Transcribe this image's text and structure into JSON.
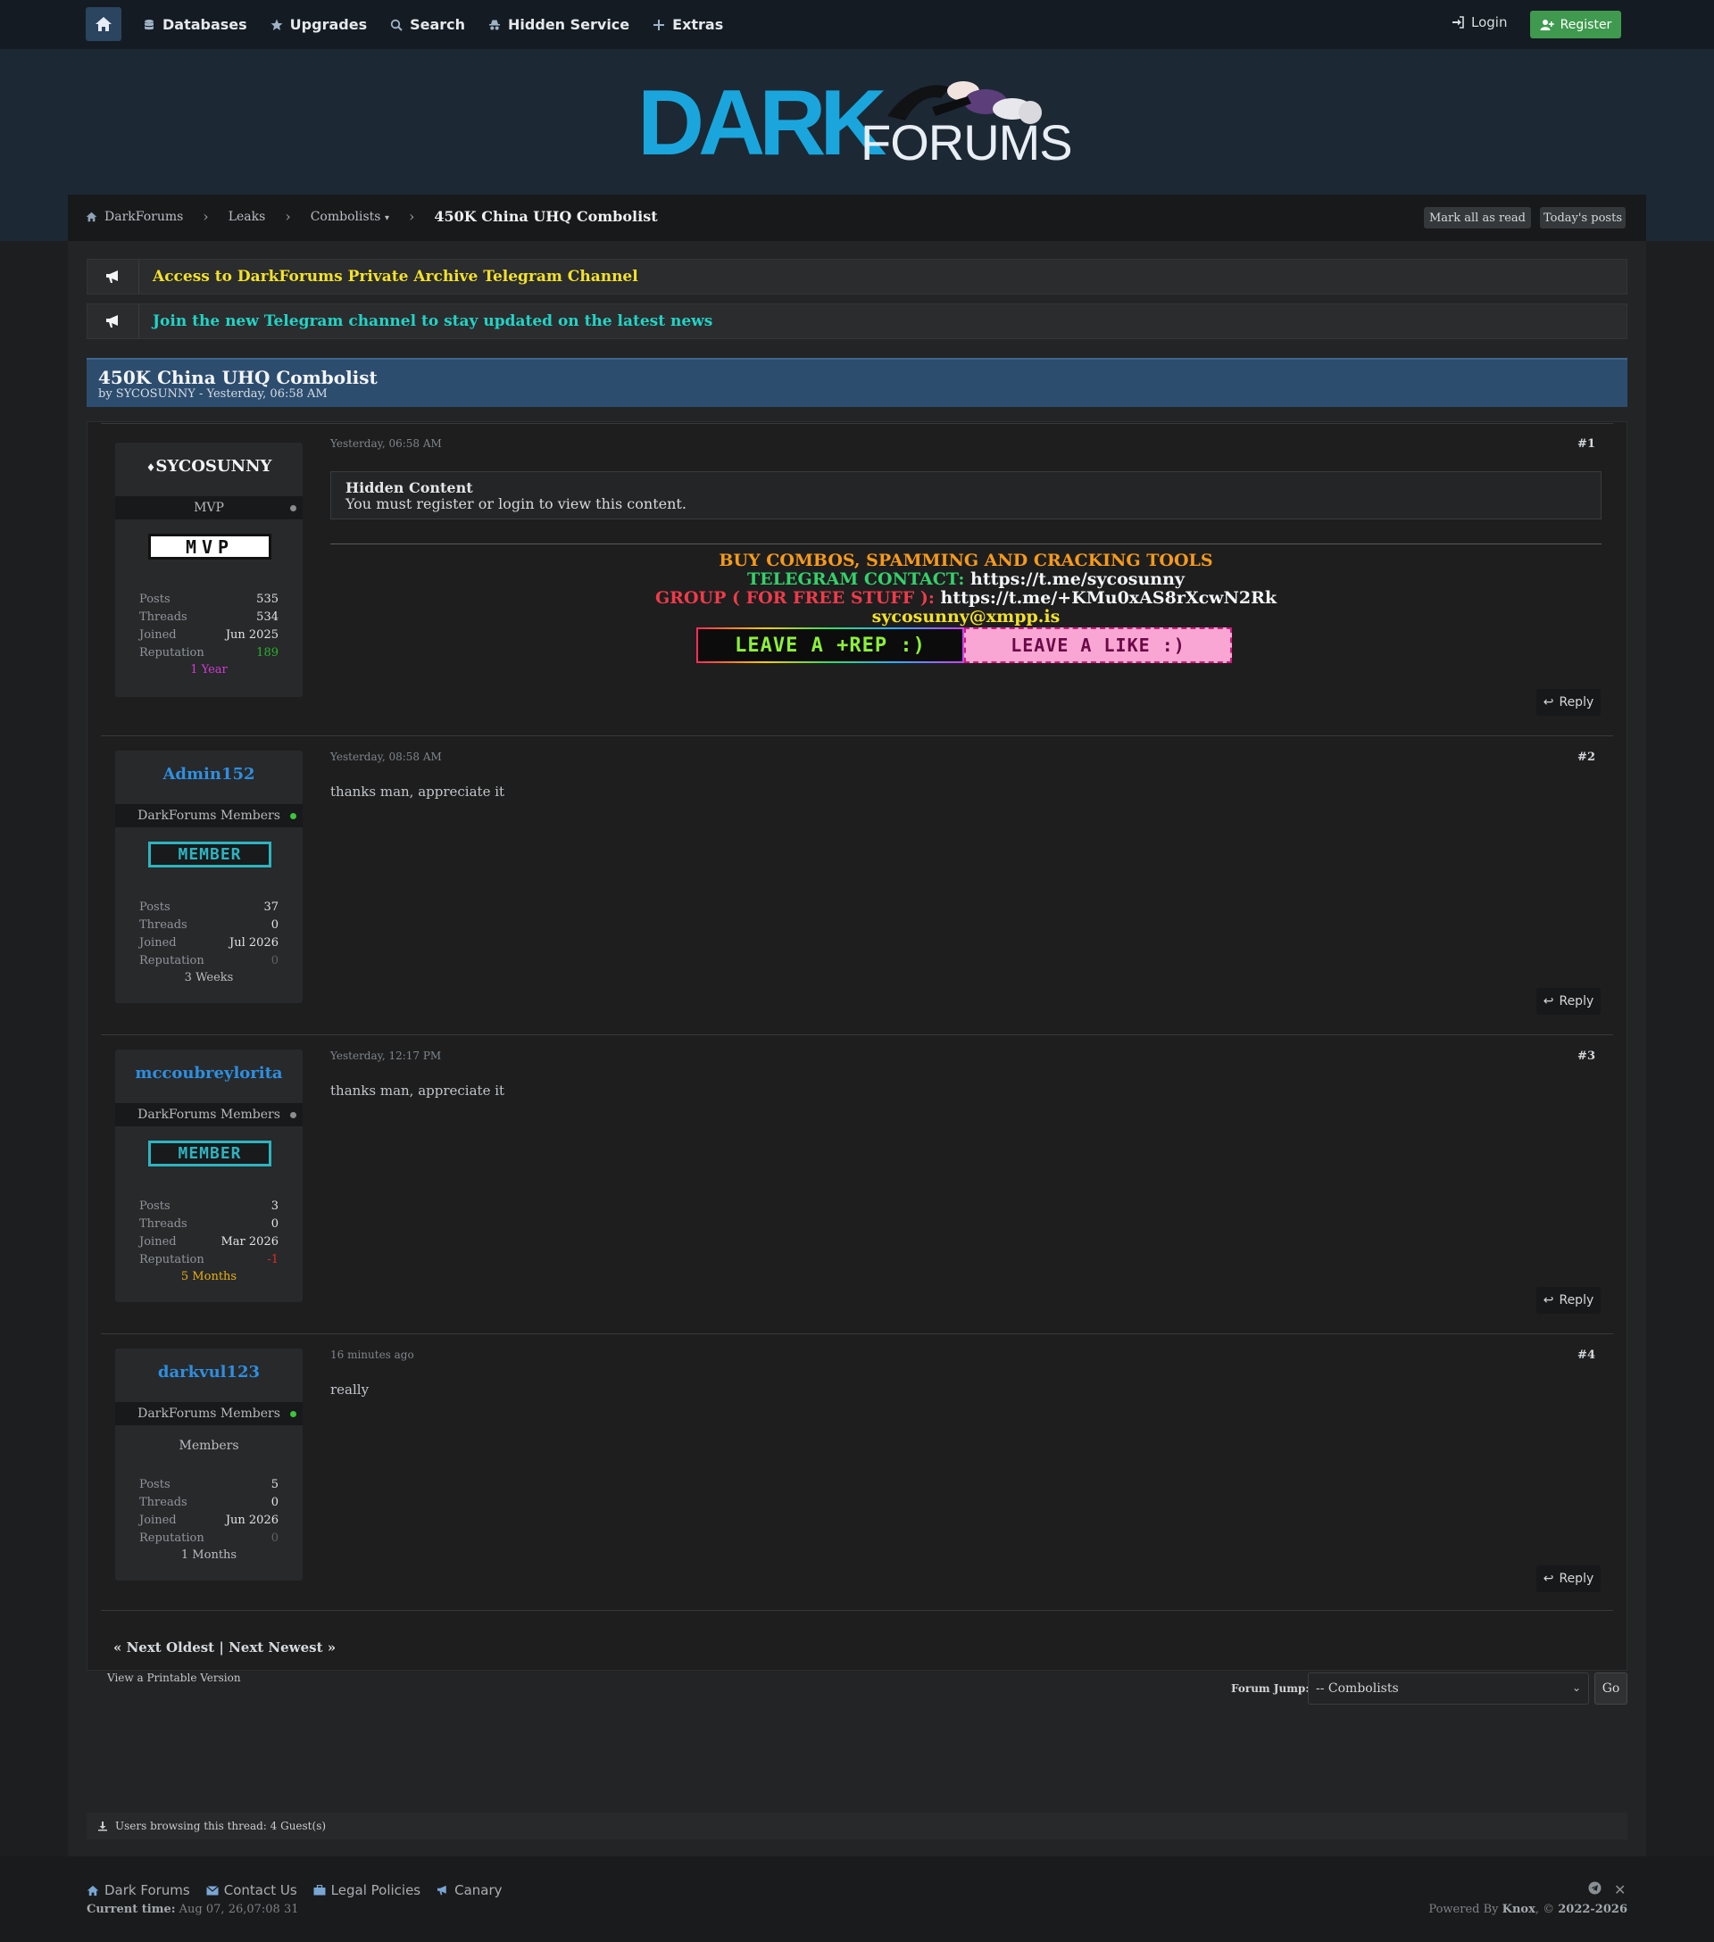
{
  "nav": {
    "items": [
      {
        "label": "Databases",
        "icon": "database-icon"
      },
      {
        "label": "Upgrades",
        "icon": "star-icon"
      },
      {
        "label": "Search",
        "icon": "search-icon"
      },
      {
        "label": "Hidden Service",
        "icon": "incognito-icon"
      },
      {
        "label": "Extras",
        "icon": "plus-icon"
      }
    ],
    "login": "Login",
    "register": "Register"
  },
  "logo": {
    "part1": "DARK",
    "part2": "FORUMS"
  },
  "breadcrumb": {
    "home": "DarkForums",
    "leaks": "Leaks",
    "combolists": "Combolists",
    "combolists_arrow": "▾",
    "current": "450K China UHQ Combolist"
  },
  "actions": {
    "mark_read": "Mark all as read",
    "todays_posts": "Today's posts"
  },
  "announcements": [
    {
      "text": "Access to DarkForums Private Archive Telegram Channel",
      "color": "#f2e12a"
    },
    {
      "text": "Join the new Telegram channel to stay updated on the latest news",
      "color": "#22d3c5"
    }
  ],
  "thread": {
    "title": "450K China UHQ Combolist",
    "subtitle": "by SYCOSUNNY - Yesterday, 06:58 AM"
  },
  "colors": {
    "link_blue": "#2e8fe0",
    "online": "#3ec43e",
    "offline": "#8a8d90",
    "rep_positive": "#29b12c",
    "rep_negative": "#e02a2a",
    "rep_zero": "#5e6267"
  },
  "posts": [
    {
      "username": "SYCOSUNNY",
      "group": "MVP",
      "online": false,
      "badge": "MVP",
      "stats": {
        "posts": "535",
        "threads": "534",
        "joined": "Jun 2025",
        "reputation": "189"
      },
      "tenure": "1 Year",
      "date": "Yesterday, 06:58 AM",
      "number": "#1",
      "hidden_title": "Hidden Content",
      "hidden_text": "You must register or login to view this content.",
      "sig": {
        "line1": "BUY COMBOS, SPAMMING AND CRACKING TOOLS",
        "line2_label": "TELEGRAM CONTACT:",
        "line2_value": "https://t.me/sycosunny",
        "line3_label": "GROUP ( FOR FREE STUFF ):",
        "line3_value": "https://t.me/+KMu0xAS8rXcwN2Rk",
        "line4": "sycosunny@xmpp.is",
        "banner1": "LEAVE A +REP :)",
        "banner2": "LEAVE A LIKE :)"
      }
    },
    {
      "username": "Admin152",
      "group": "DarkForums Members",
      "online": true,
      "badge": "MEMBER",
      "stats": {
        "posts": "37",
        "threads": "0",
        "joined": "Jul 2026",
        "reputation": "0"
      },
      "tenure": "3 Weeks",
      "date": "Yesterday, 08:58 AM",
      "number": "#2",
      "body": "thanks man, appreciate it"
    },
    {
      "username": "mccoubreylorita",
      "group": "DarkForums Members",
      "online": false,
      "badge": "MEMBER",
      "stats": {
        "posts": "3",
        "threads": "0",
        "joined": "Mar 2026",
        "reputation": "-1"
      },
      "tenure": "5 Months",
      "date": "Yesterday, 12:17 PM",
      "number": "#3",
      "body": "thanks man, appreciate it"
    },
    {
      "username": "darkvul123",
      "group": "DarkForums Members",
      "online": true,
      "group_text": "Members",
      "stats": {
        "posts": "5",
        "threads": "0",
        "joined": "Jun 2026",
        "reputation": "0"
      },
      "tenure": "1 Months",
      "date": "16 minutes ago",
      "number": "#4",
      "body": "really"
    }
  ],
  "labels": {
    "posts": "Posts",
    "threads": "Threads",
    "joined": "Joined",
    "reputation": "Reputation",
    "reply": "Reply"
  },
  "pagenav": {
    "oldest": "« Next Oldest",
    "sep": "|",
    "newest": "Next Newest »"
  },
  "printable": "View a Printable Version",
  "forum_jump": {
    "label": "Forum Jump:",
    "selected": "-- Combolists",
    "go": "Go"
  },
  "browsing": "Users browsing this thread: 4 Guest(s)",
  "footer": {
    "links": [
      "Dark Forums",
      "Contact Us",
      "Legal Policies",
      "Canary"
    ],
    "current_time_label": "Current time:",
    "current_time": "Aug 07, 26,07:08 31",
    "powered_prefix": "Powered By",
    "powered_name": "Knox",
    "powered_suffix": ", ©",
    "years": "2022-2026"
  }
}
